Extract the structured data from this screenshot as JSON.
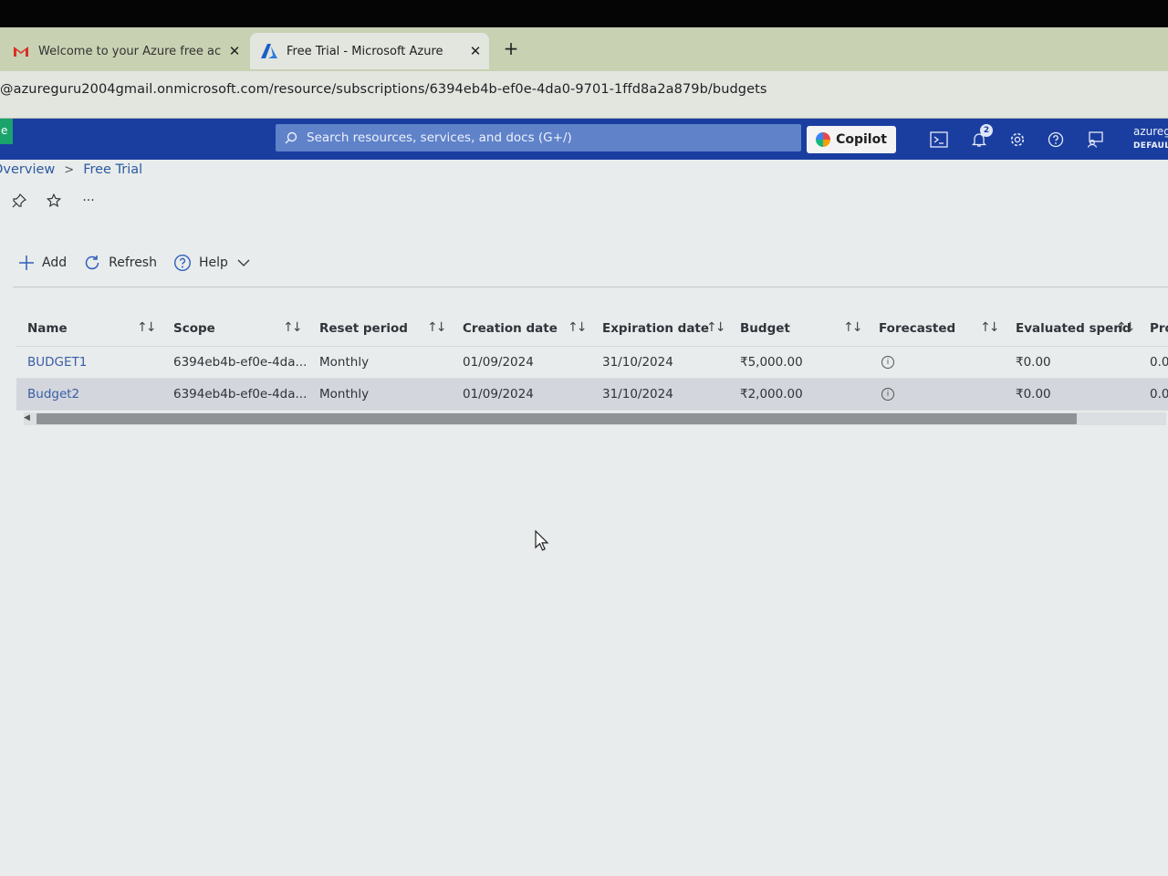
{
  "browser": {
    "tabs": [
      {
        "title": "Welcome to your Azure free ac",
        "favicon": "gmail-icon",
        "close": "✕"
      },
      {
        "title": "Free Trial - Microsoft Azure",
        "favicon": "azure-icon",
        "close": "✕"
      }
    ],
    "new_tab": "+",
    "address": "@azureguru2004gmail.onmicrosoft.com/resource/subscriptions/6394eb4b-ef0e-4da0-9701-1ffd8a2a879b/budgets"
  },
  "azure_header": {
    "brand_fragment": "e",
    "search_placeholder": "Search resources, services, and docs (G+/)",
    "copilot_label": "Copilot",
    "notification_count": "2",
    "account_name": "azureg",
    "account_directory": "DEFAULT"
  },
  "breadcrumb": {
    "items": [
      "Overview",
      "Free Trial"
    ],
    "separator": ">"
  },
  "commands": {
    "add": "Add",
    "refresh": "Refresh",
    "help": "Help"
  },
  "table": {
    "columns": [
      "Name",
      "Scope",
      "Reset period",
      "Creation date",
      "Expiration date",
      "Budget",
      "Forecasted",
      "Evaluated spend",
      "Pro"
    ],
    "rows": [
      {
        "name": "BUDGET1",
        "scope": "6394eb4b-ef0e-4da...",
        "reset": "Monthly",
        "created": "01/09/2024",
        "expires": "31/10/2024",
        "budget": "₹5,000.00",
        "forecasted": "info",
        "evaluated": "₹0.00",
        "pro": "0.0"
      },
      {
        "name": "Budget2",
        "scope": "6394eb4b-ef0e-4da...",
        "reset": "Monthly",
        "created": "01/09/2024",
        "expires": "31/10/2024",
        "budget": "₹2,000.00",
        "forecasted": "info",
        "evaluated": "₹0.00",
        "pro": "0.0"
      }
    ],
    "selected_row": "Budget2"
  },
  "colors": {
    "azure_header": "#1a3ea0",
    "tab_strip": "#c8d1b2",
    "link": "#2c5aa0"
  }
}
